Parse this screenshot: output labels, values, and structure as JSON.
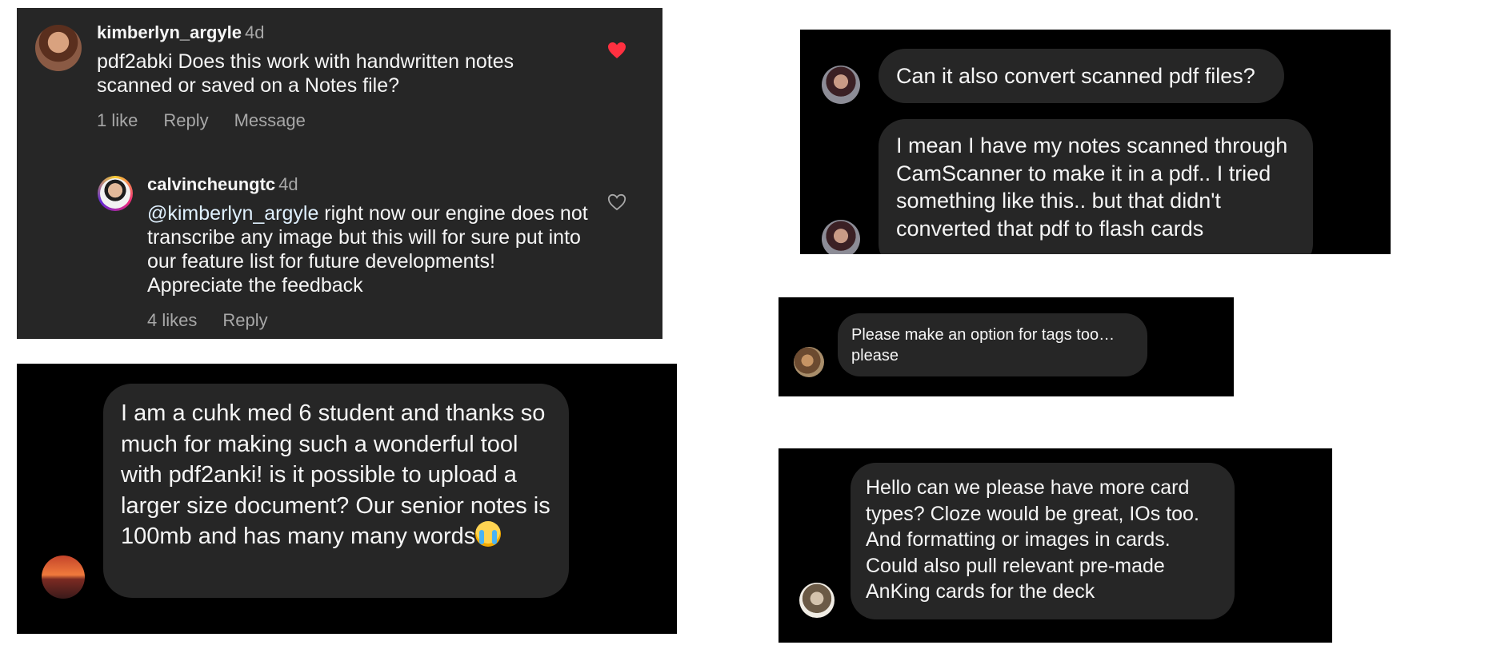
{
  "comments": {
    "main": {
      "username": "kimberlyn_argyle",
      "time": "4d",
      "text": "pdf2abki Does this work with handwritten notes scanned or saved on a Notes file?",
      "likes": "1 like",
      "reply": "Reply",
      "message": "Message",
      "liked": true
    },
    "reply": {
      "username": "calvincheungtc",
      "time": "4d",
      "mention": "@kimberlyn_argyle",
      "text": " right now our engine does not transcribe any image but this will for sure put into our feature list for future developments! Appreciate the feedback",
      "likes": "4 likes",
      "reply": "Reply",
      "liked": false
    }
  },
  "chat1": {
    "message": "I am a cuhk med 6 student and thanks so much for making such a wonderful tool with pdf2anki! is it possible to upload a larger size document? Our senior notes is 100mb and has many many words",
    "emoji": "loudly-crying-face"
  },
  "chat2": {
    "message1": "Can it also convert scanned pdf files?",
    "message2": "I mean I have my notes scanned through CamScanner to make it in a pdf.. I tried something like this.. but that didn't converted that pdf to flash cards"
  },
  "chat3": {
    "message": "Please make an option for tags too… please"
  },
  "chat4": {
    "message": "Hello can we please have more card types? Cloze would be great, IOs too. And formatting or images in cards. Could also pull relevant pre-made AnKing cards for the deck"
  },
  "colors": {
    "comment_bg": "#262626",
    "chat_bg": "#000000",
    "bubble_bg": "#262626",
    "heart_liked": "#ff3040",
    "muted_text": "#a8a8a8"
  }
}
